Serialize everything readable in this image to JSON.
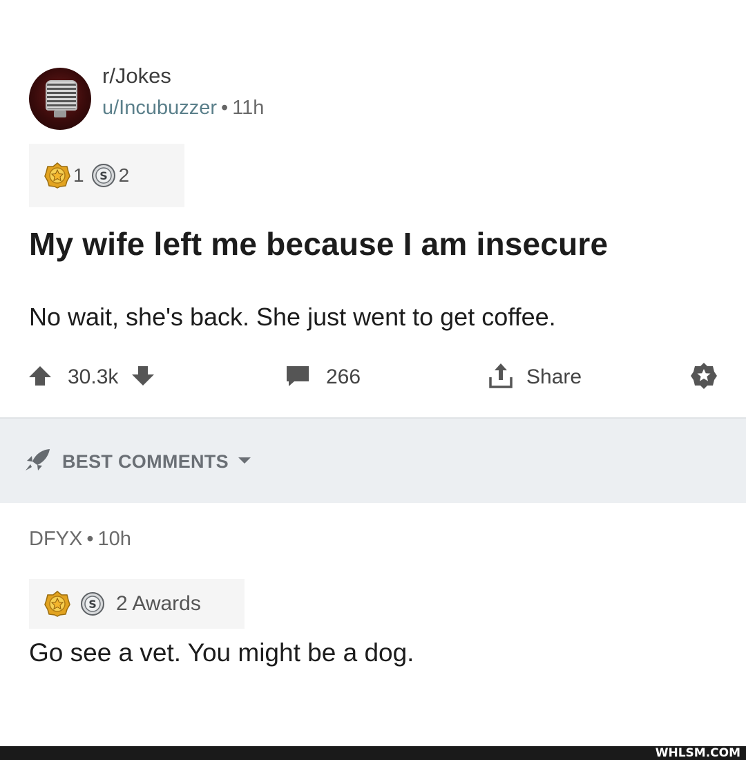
{
  "post": {
    "subreddit": "r/Jokes",
    "author": "u/Incubuzzer",
    "separator": "•",
    "age": "11h",
    "awards": {
      "gold_count": "1",
      "silver_count": "2"
    },
    "title": "My wife left me because I am insecure",
    "body": "No wait, she's back. She just went to get coffee."
  },
  "actions": {
    "score": "30.3k",
    "comments": "266",
    "share_label": "Share"
  },
  "sort": {
    "label": "BEST COMMENTS"
  },
  "comment": {
    "author": "DFYX",
    "separator": "•",
    "age": "10h",
    "awards_label": "2 Awards",
    "body": "Go see a vet. You might be a dog."
  },
  "watermark": "WHLSM.COM",
  "colors": {
    "gold": "#f0b429",
    "silver": "#8a8f94",
    "byline": "#5a7f8a",
    "sort_bg": "#eceff2"
  },
  "icons": [
    "avatar-microphone",
    "gold-award-icon",
    "silver-award-icon",
    "upvote-arrow-icon",
    "downvote-arrow-icon",
    "comment-bubble-icon",
    "share-upload-icon",
    "save-star-icon",
    "rocket-icon",
    "caret-down-icon"
  ]
}
